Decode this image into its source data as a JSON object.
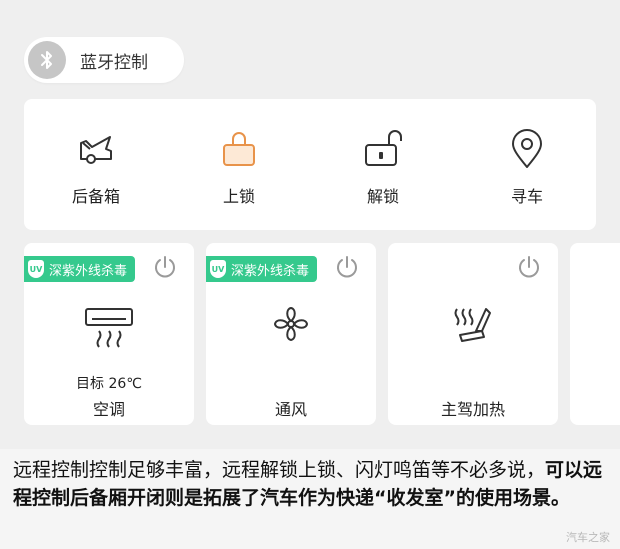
{
  "bluetooth": {
    "label": "蓝牙控制",
    "icon": "bluetooth-icon"
  },
  "quick_actions": [
    {
      "label": "后备箱",
      "icon": "trunk-icon"
    },
    {
      "label": "上锁",
      "icon": "lock-icon",
      "accent": "#e8934a"
    },
    {
      "label": "解锁",
      "icon": "unlock-icon"
    },
    {
      "label": "寻车",
      "icon": "locate-car-icon"
    }
  ],
  "climate_cards": [
    {
      "badge": "深紫外线杀毒",
      "badge_icon_text": "UV",
      "subtitle": "目标 26℃",
      "label": "空调",
      "icon": "air-conditioner-icon",
      "power_icon": "power-icon"
    },
    {
      "badge": "深紫外线杀毒",
      "badge_icon_text": "UV",
      "label": "通风",
      "icon": "fan-icon",
      "power_icon": "power-icon"
    },
    {
      "label": "主驾加热",
      "icon": "seat-heat-icon",
      "power_icon": "power-icon"
    }
  ],
  "caption": {
    "normal": "远程控制控制足够丰富，远程解锁上锁、闪灯鸣笛等不必多说，",
    "bold": "可以远程控制后备厢开闭则是拓展了汽车作为快递“收发室”的使用场景。"
  },
  "watermark": "汽车之家",
  "colors": {
    "uv_badge": "#35c98d",
    "lock_accent": "#e8934a",
    "card_bg": "#ffffff",
    "page_bg": "#efefef"
  }
}
